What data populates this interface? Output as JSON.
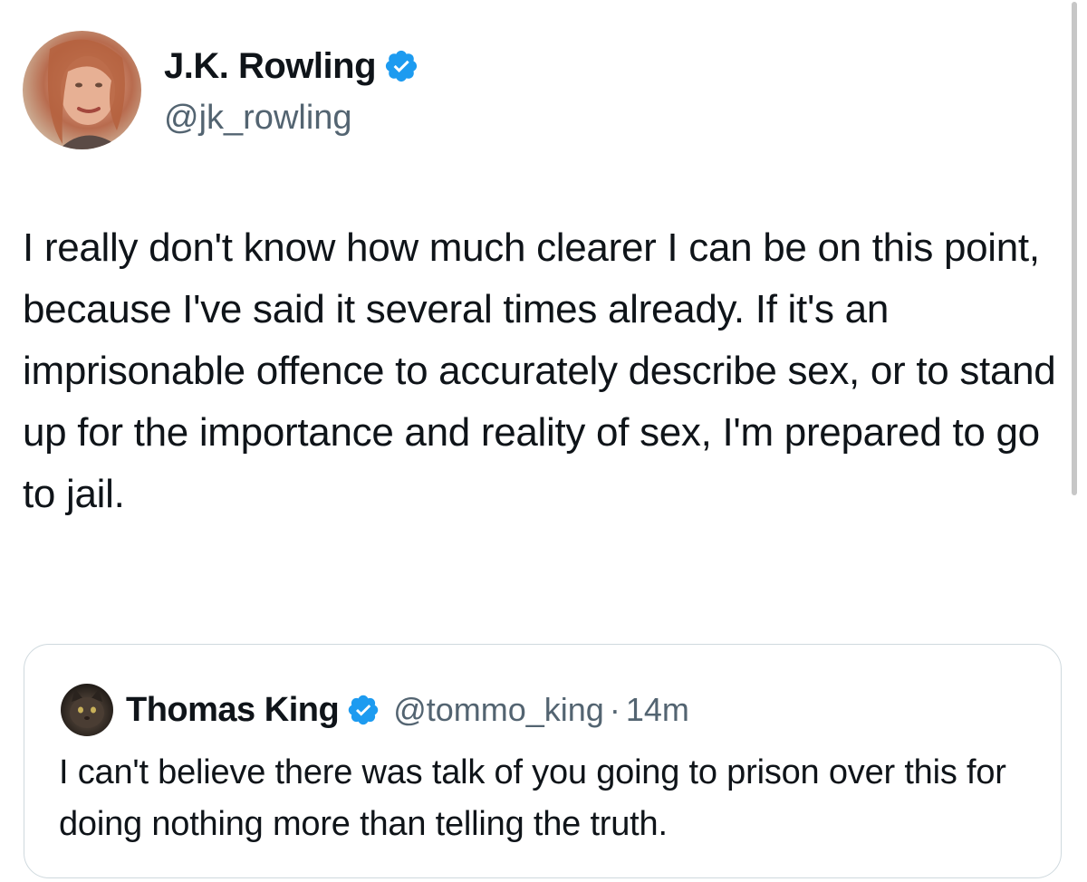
{
  "tweet": {
    "author": {
      "name": "J.K. Rowling",
      "handle": "@jk_rowling",
      "verified": true,
      "avatar_icon": "profile-photo"
    },
    "text": "I really don't know how much clearer I can be on this point, because I've said it several times already. If it's an imprisonable offence to accurately describe sex, or to stand up for the importance and reality of sex, I'm prepared to go to jail."
  },
  "quoted_tweet": {
    "author": {
      "name": "Thomas King",
      "handle": "@tommo_king",
      "verified": true,
      "avatar_icon": "cat-photo"
    },
    "separator": "·",
    "time": "14m",
    "text": "I can't believe there was talk of you going to prison over this for doing nothing more than telling the truth."
  },
  "colors": {
    "verified_badge": "#1d9bf0",
    "text_primary": "#0f1419",
    "text_secondary": "#536471",
    "border": "#cfd9de"
  }
}
